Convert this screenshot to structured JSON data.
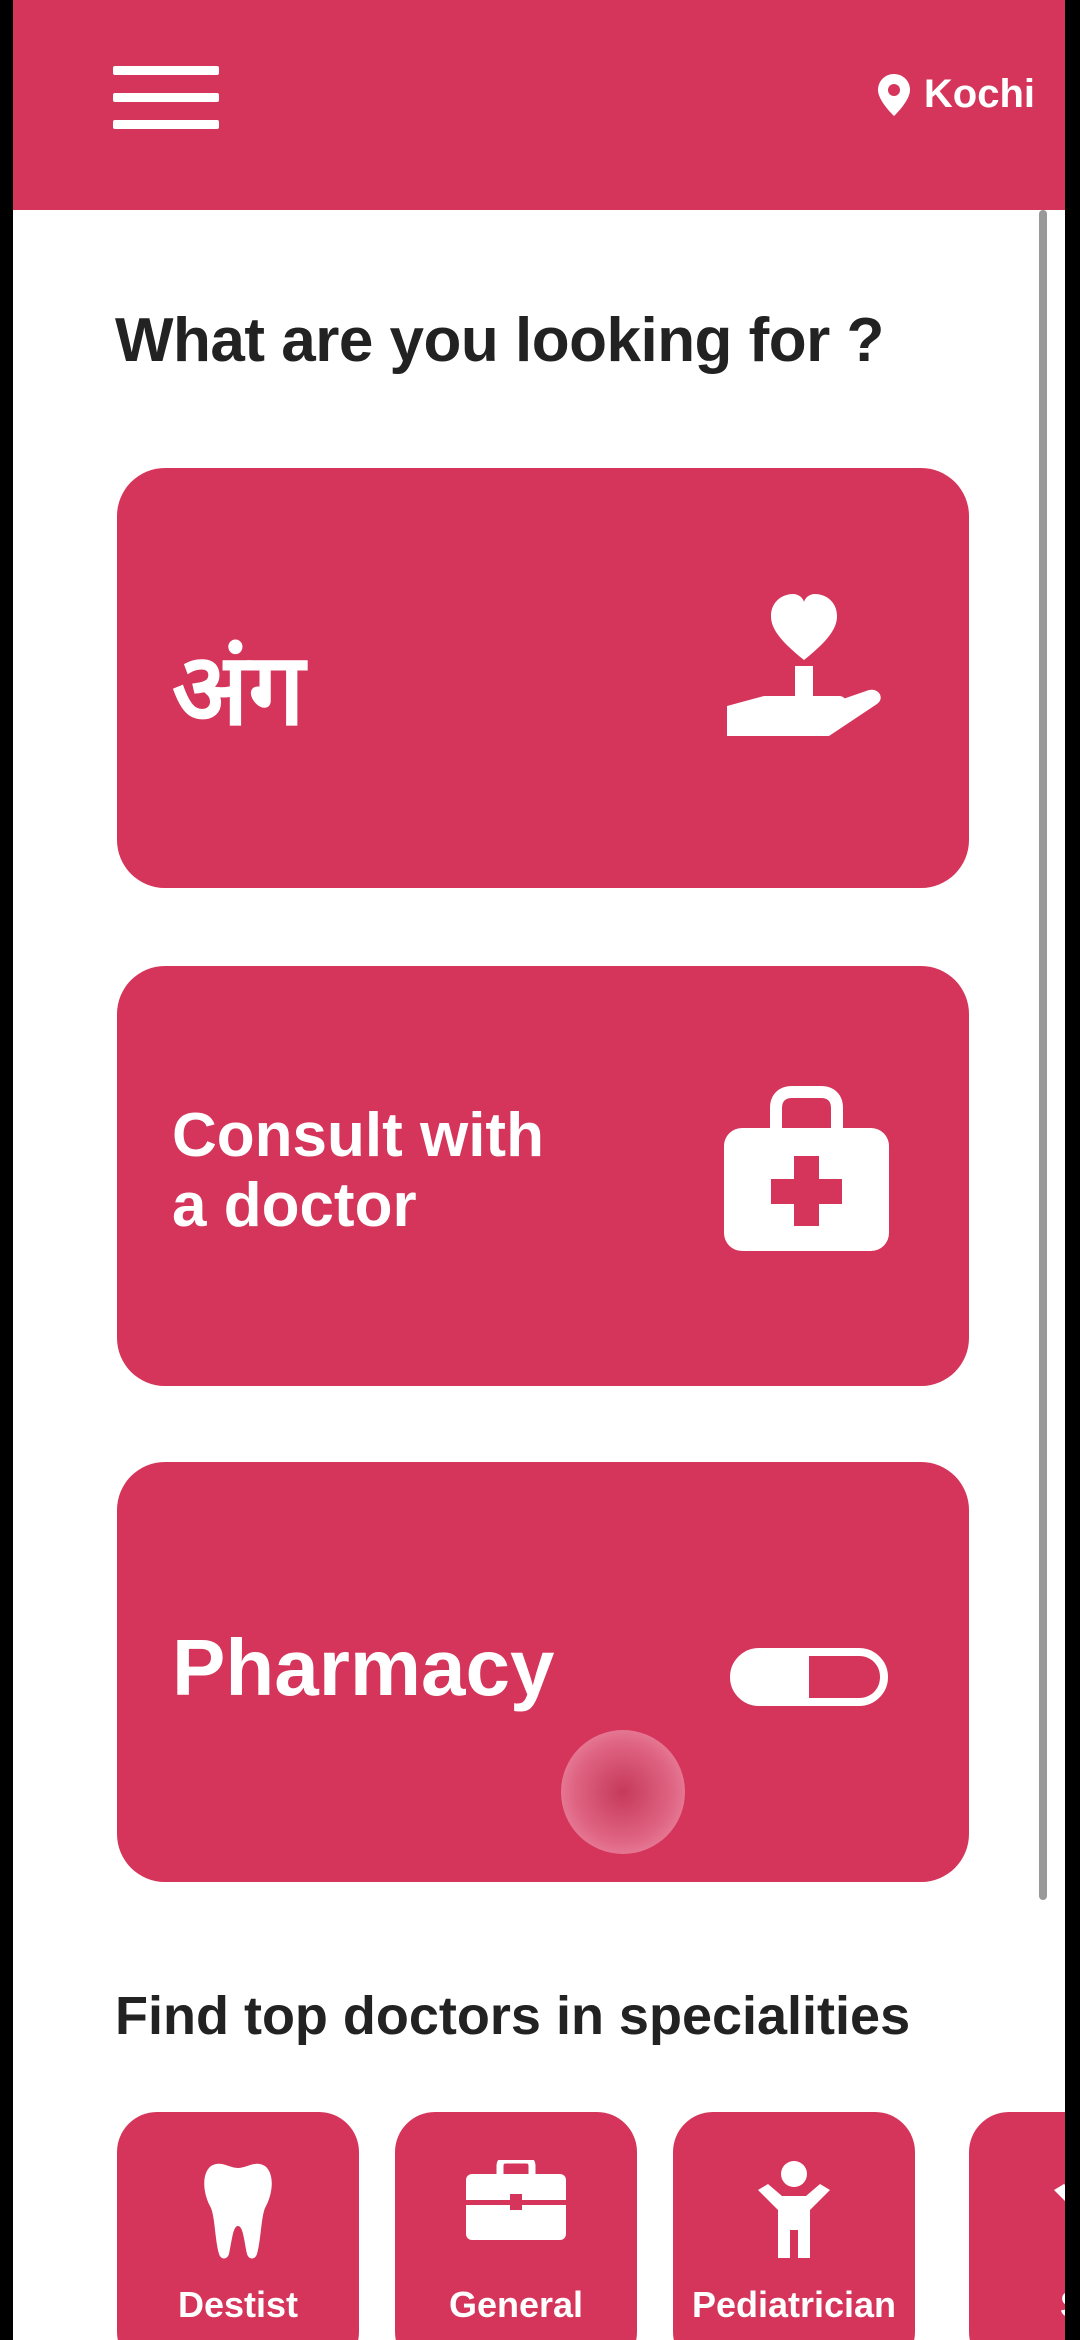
{
  "header": {
    "menu_icon": "hamburger-menu-icon",
    "location_icon": "map-pin-icon",
    "location": "Kochi"
  },
  "heading": "What are you looking for ?",
  "cards": [
    {
      "label": "अंग",
      "icon": "heart-in-hand-icon"
    },
    {
      "label": "Consult with a doctor",
      "icon": "medical-kit-icon"
    },
    {
      "label": "Pharmacy",
      "icon": "pill-icon"
    }
  ],
  "specialities": {
    "title": "Find top doctors in specialities",
    "items": [
      {
        "label": "Destist",
        "icon": "tooth-icon"
      },
      {
        "label": "General",
        "icon": "briefcase-icon"
      },
      {
        "label": "Pediatrician",
        "icon": "child-icon"
      },
      {
        "label": "Sur",
        "icon": "person-icon"
      }
    ]
  },
  "colors": {
    "accent": "#d5355a",
    "text": "#222222",
    "background": "#ffffff"
  }
}
